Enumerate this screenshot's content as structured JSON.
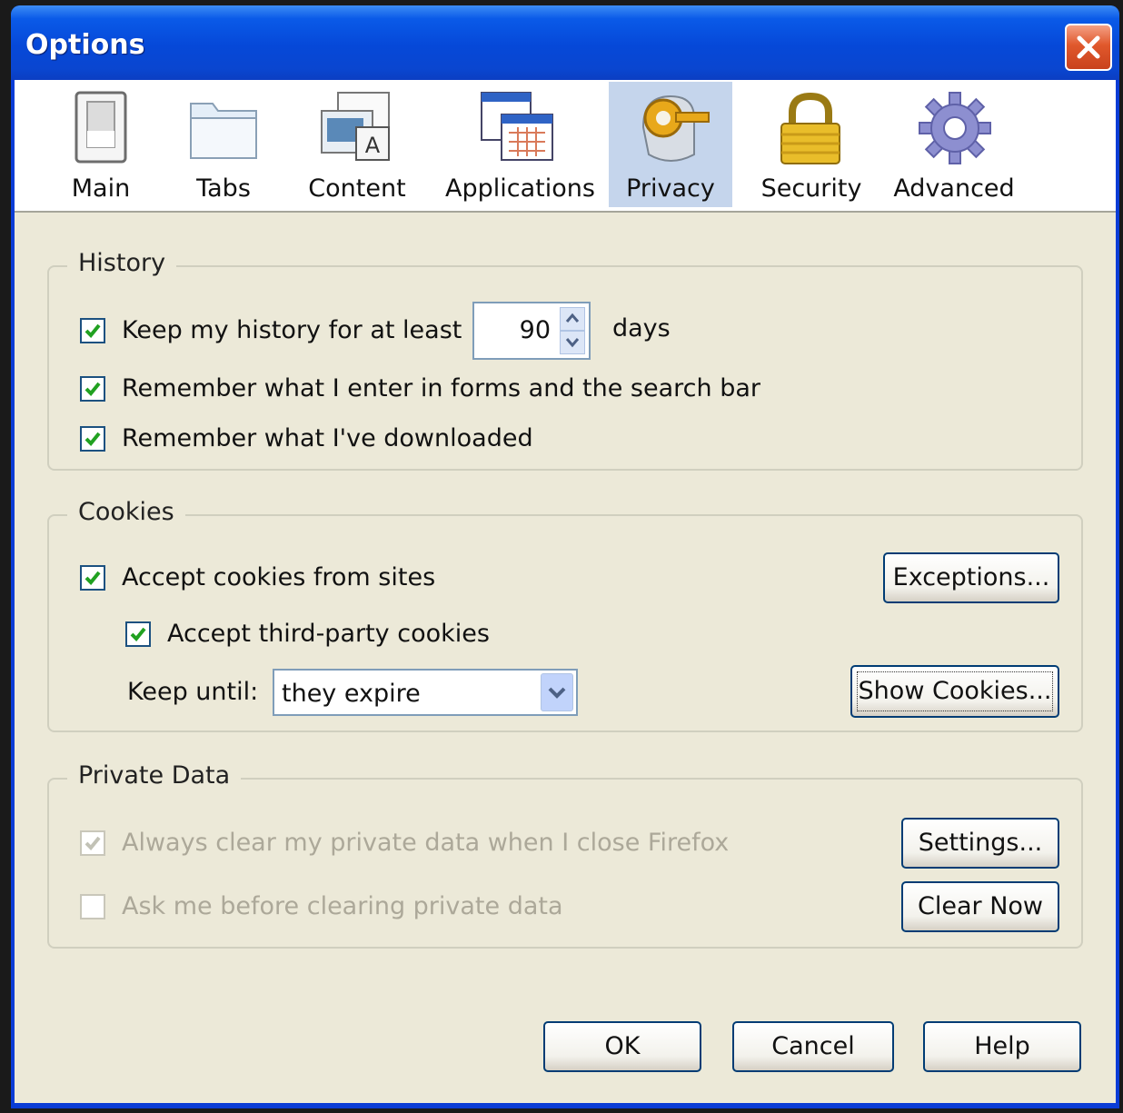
{
  "window": {
    "title": "Options"
  },
  "toolbar": {
    "tabs": [
      {
        "label": "Main",
        "icon": "main-panel-icon"
      },
      {
        "label": "Tabs",
        "icon": "tabs-folder-icon"
      },
      {
        "label": "Content",
        "icon": "content-icon"
      },
      {
        "label": "Applications",
        "icon": "applications-icon"
      },
      {
        "label": "Privacy",
        "icon": "privacy-mask-icon",
        "selected": true
      },
      {
        "label": "Security",
        "icon": "padlock-icon"
      },
      {
        "label": "Advanced",
        "icon": "gear-icon"
      }
    ]
  },
  "history": {
    "legend": "History",
    "keep_history_label": "Keep my history for at least",
    "keep_history_checked": true,
    "days_value": "90",
    "days_unit": "days",
    "remember_forms_label": "Remember what I enter in forms and the search bar",
    "remember_forms_checked": true,
    "remember_downloads_label": "Remember what I've downloaded",
    "remember_downloads_checked": true
  },
  "cookies": {
    "legend": "Cookies",
    "accept_label": "Accept cookies from sites",
    "accept_checked": true,
    "third_party_label": "Accept third-party cookies",
    "third_party_checked": true,
    "keep_until_label": "Keep until:",
    "keep_until_value": "they expire",
    "exceptions_button": "Exceptions...",
    "show_cookies_button": "Show Cookies..."
  },
  "private_data": {
    "legend": "Private Data",
    "always_clear_label": "Always clear my private data when I close Firefox",
    "always_clear_checked": true,
    "ask_before_label": "Ask me before clearing private data",
    "ask_before_checked": false,
    "settings_button": "Settings...",
    "clear_now_button": "Clear Now"
  },
  "footer": {
    "ok_button": "OK",
    "cancel_button": "Cancel",
    "help_button": "Help"
  },
  "colors": {
    "titlebar": "#0a4ad6",
    "dialog_background": "#ece9d8",
    "selected_tab": "#c5d5ec",
    "checkmark": "#21a121",
    "close_button": "#e0582c"
  }
}
